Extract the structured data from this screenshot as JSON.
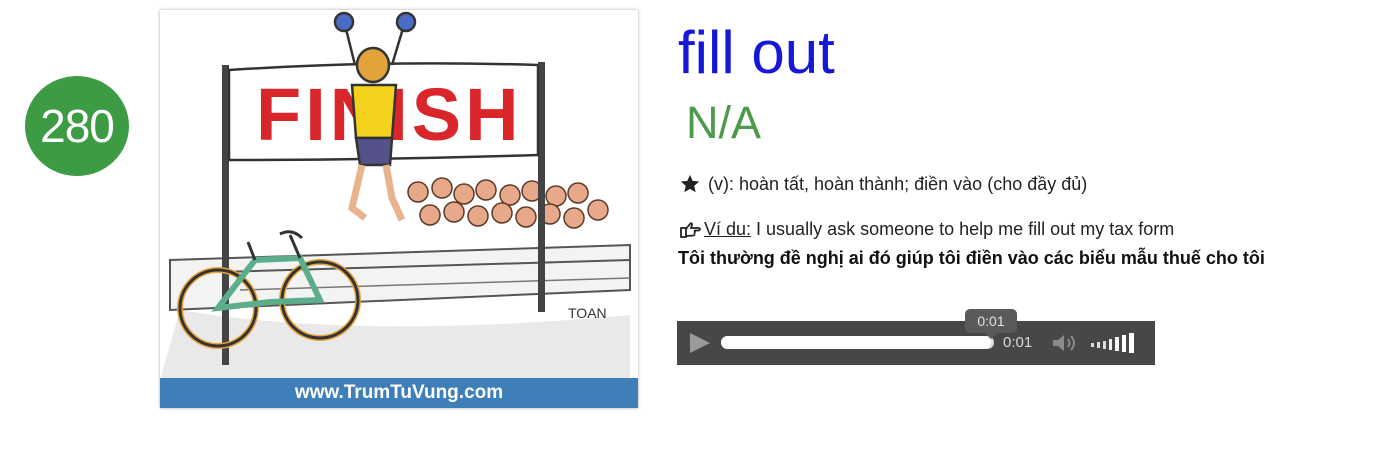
{
  "card_number": "280",
  "image": {
    "banner_text": "FINISH",
    "footer_text": "www.TrumTuVung.com"
  },
  "entry": {
    "word": "fill out",
    "phonetic": "N/A",
    "meaning": "(v): hoàn tất, hoàn thành; điền vào (cho đầy đủ)",
    "example_label": "Ví du:",
    "example_text": "I usually ask someone to help me fill out my tax form",
    "translation": "Tôi thường đề nghị ai đó giúp tôi điền vào các biểu mẫu thuế cho tôi"
  },
  "player": {
    "tooltip_time": "0:01",
    "current_time": "0:01",
    "progress": 0.99
  },
  "icons": {
    "meaning": "star-icon",
    "example": "pointing-hand-icon",
    "play": "play-icon",
    "volume": "speaker-icon"
  },
  "colors": {
    "badge": "#3d9b43",
    "word": "#1717d6",
    "phonetic": "#4c9a4c",
    "player_bg": "#474747",
    "footer_bg": "#3f7fb9",
    "banner_text": "#d8262a"
  }
}
